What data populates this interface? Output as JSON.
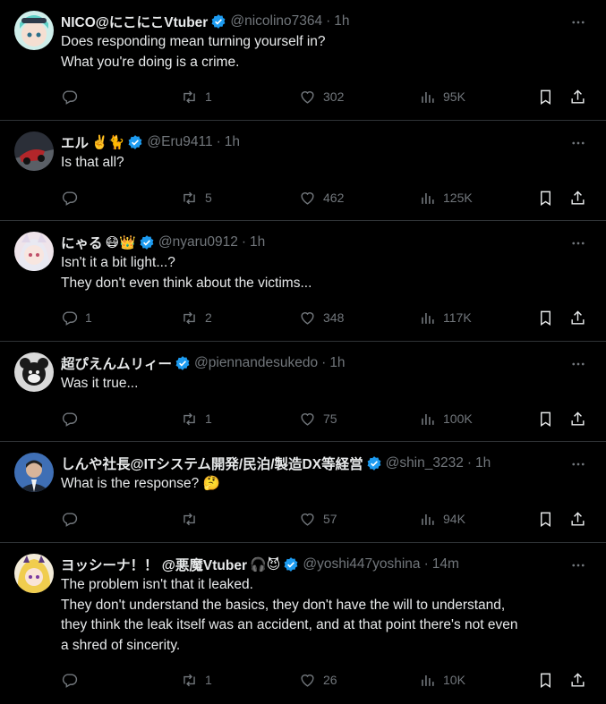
{
  "colors": {
    "background": "#000000",
    "text": "#e7e9ea",
    "muted": "#71767b",
    "verified": "#1d9bf0",
    "divider": "#2f3336"
  },
  "icons": {
    "reply": "reply-icon",
    "retweet": "retweet-icon",
    "like": "heart-icon",
    "views": "views-icon",
    "bookmark": "bookmark-icon",
    "share": "share-icon",
    "more": "more-icon",
    "verified": "verified-badge-icon"
  },
  "tweets": [
    {
      "name": "NICO@にこにこVtuber",
      "emoji": "",
      "handle": "@nicolino7364",
      "time": "1h",
      "lines": [
        "Does responding mean turning yourself in?",
        "What you're doing is a crime."
      ],
      "replies": "",
      "retweets": "1",
      "likes": "302",
      "views": "95K"
    },
    {
      "name": "エル",
      "emoji": "✌️🐈",
      "handle": "@Eru9411",
      "time": "1h",
      "lines": [
        "Is that all?"
      ],
      "replies": "",
      "retweets": "5",
      "likes": "462",
      "views": "125K"
    },
    {
      "name": "にゃる",
      "emoji": "😷👑",
      "handle": "@nyaru0912",
      "time": "1h",
      "lines": [
        "Isn't it a bit light...?",
        "They don't even think about the victims..."
      ],
      "replies": "1",
      "retweets": "2",
      "likes": "348",
      "views": "117K"
    },
    {
      "name": "超ぴえんムリィー",
      "emoji": "",
      "handle": "@piennandesukedo",
      "time": "1h",
      "lines": [
        "Was it true..."
      ],
      "replies": "",
      "retweets": "1",
      "likes": "75",
      "views": "100K"
    },
    {
      "name": "しんや社長@ITシステム開発/民泊/製造DX等経営",
      "emoji": "",
      "handle": "@shin_3232",
      "time": "1h",
      "lines": [
        "What is the response? 🤔"
      ],
      "replies": "",
      "retweets": "",
      "likes": "57",
      "views": "94K"
    },
    {
      "name": "ヨッシーナ！！ @悪魔Vtuber",
      "emoji": "🎧😈",
      "handle": "@yoshi447yoshina",
      "time": "14m",
      "lines": [
        "The problem isn't that it leaked.",
        "They don't understand the basics, they don't have the will to understand,",
        "they think the leak itself was an accident, and at that point there's not even",
        "a shred of sincerity."
      ],
      "replies": "",
      "retweets": "1",
      "likes": "26",
      "views": "10K"
    }
  ]
}
